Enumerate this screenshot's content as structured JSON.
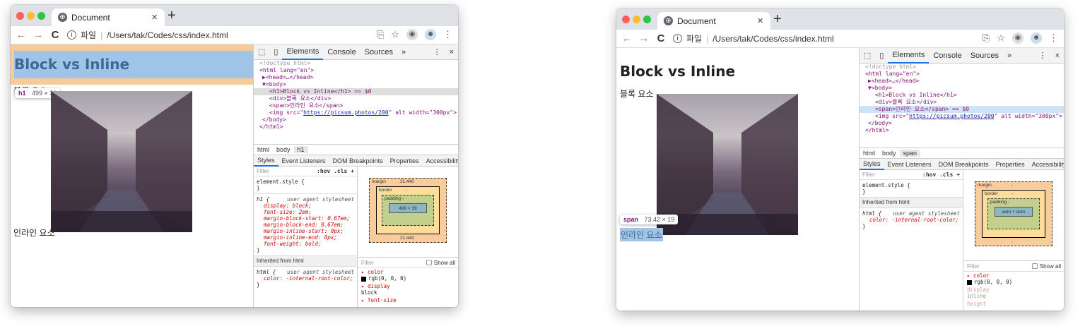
{
  "left": {
    "tab_title": "Document",
    "url_prefix": "파일",
    "url": "/Users/tak/Codes/css/index.html",
    "page": {
      "h1": "Block vs Inline",
      "block_text": "블록 요소",
      "inline_text": "인라인 요소"
    },
    "tooltip": {
      "tag": "h1",
      "size": "499 × 39"
    },
    "devtools": {
      "tabs": [
        "Elements",
        "Console",
        "Sources",
        "»"
      ],
      "dom": {
        "doctype": "<!doctype html>",
        "html_open": "<html lang=\"en\">",
        "head": "▶<head>…</head>",
        "body_open": "▼<body>",
        "line_h1": "<h1>Block vs Inline</h1> == $0",
        "line_div": "<div>블록 요소</div>",
        "line_span": "<span>인라인 요소</span>",
        "img_pre": "<img src=\"",
        "img_link": "https://picsum.photos/200",
        "img_post": "\" alt width=\"300px\">",
        "body_close": "</body>",
        "html_close": "</html>"
      },
      "crumbs": [
        "html",
        "body",
        "h1"
      ],
      "subtabs": [
        "Styles",
        "Event Listeners",
        "DOM Breakpoints",
        "Properties",
        "Accessibility"
      ],
      "filter": "Filter",
      "hov": ":hov .cls +",
      "element_style": "element.style {",
      "close_brace": "}",
      "rule_sel": "h1 {",
      "rule_src": "user agent stylesheet",
      "rule_props": [
        "display: block;",
        "font-size: 2em;",
        "margin-block-start: 0.67em;",
        "margin-block-end: 0.67em;",
        "margin-inline-start: 0px;",
        "margin-inline-end: 0px;",
        "font-weight: bold;"
      ],
      "inherited": "Inherited from html",
      "inh_sel": "html {",
      "inh_prop": "color: -internal-root-color;",
      "box": {
        "margin_label": "margin",
        "margin_val": "21.440",
        "margin_bottom": "21.440",
        "border_label": "border",
        "border_val": "-",
        "padding_label": "padding -",
        "content": "499 × 39",
        "side": "-"
      },
      "computed_filter": "Filter",
      "show_all": "Show all",
      "computed": [
        {
          "name": "color",
          "value": "rgb(0, 0, 0)"
        },
        {
          "name": "display",
          "value": "block"
        },
        {
          "name": "font-size",
          "value": ""
        }
      ]
    }
  },
  "right": {
    "tab_title": "Document",
    "url_prefix": "파일",
    "url": "/Users/tak/Codes/css/index.html",
    "page": {
      "h1": "Block vs Inline",
      "block_text": "블록 요소",
      "inline_text": "인라인 요소"
    },
    "tooltip": {
      "tag": "span",
      "size": "73.42 × 19"
    },
    "devtools": {
      "tabs": [
        "Elements",
        "Console",
        "Sources",
        "»"
      ],
      "dom": {
        "doctype": "<!doctype html>",
        "html_open": "<html lang=\"en\">",
        "head": "▶<head>…</head>",
        "body_open": "▼<body>",
        "line_h1": "<h1>Block vs Inline</h1>",
        "line_div": "<div>블록 요소</div>",
        "line_span": "<span>인라인 요소</span> == $0",
        "img_pre": "<img src=\"",
        "img_link": "https://picsum.photos/200",
        "img_post": "\" alt width=\"300px\">",
        "body_close": "</body>",
        "html_close": "</html>"
      },
      "crumbs": [
        "html",
        "body",
        "span"
      ],
      "subtabs": [
        "Styles",
        "Event Listeners",
        "DOM Breakpoints",
        "Properties",
        "Accessibility"
      ],
      "filter": "Filter",
      "hov": ":hov .cls +",
      "element_style": "element.style {",
      "close_brace": "}",
      "inherited": "Inherited from html",
      "inh_sel": "html {",
      "inh_src": "user agent stylesheet",
      "inh_prop": "color: -internal-root-color;",
      "box": {
        "margin_label": "margin",
        "margin_val": "-",
        "border_label": "border",
        "border_val": "-",
        "padding_label": "padding -",
        "content": "auto × auto",
        "side": "-"
      },
      "computed_filter": "Filter",
      "show_all": "Show all",
      "computed": [
        {
          "name": "color",
          "value": "rgb(0, 0, 0)"
        },
        {
          "name": "display",
          "value": "inline"
        },
        {
          "name": "height",
          "value": ""
        }
      ]
    }
  }
}
